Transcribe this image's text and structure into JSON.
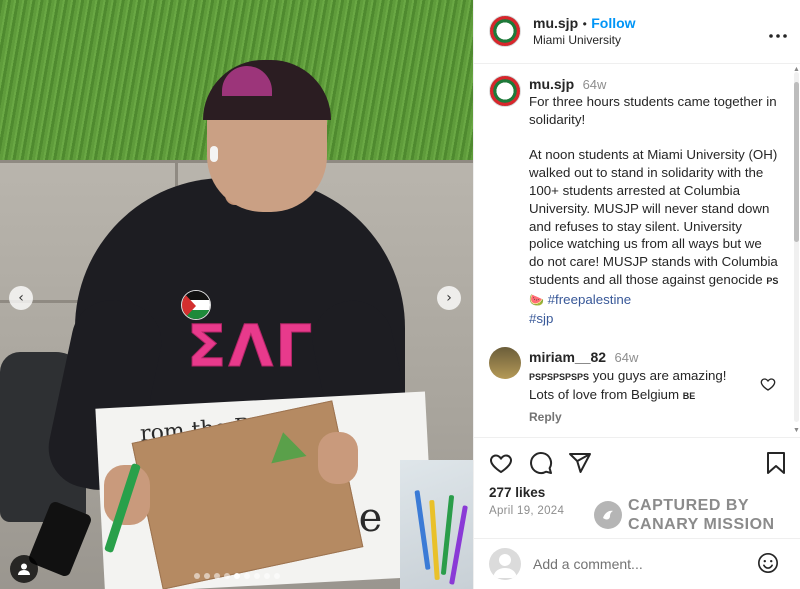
{
  "post_header": {
    "username": "mu.sjp",
    "separator": "•",
    "follow_label": "Follow",
    "location": "Miami University",
    "more_label": "•••"
  },
  "caption": {
    "username": "mu.sjp",
    "time": "64w",
    "text_main": "For three hours students came together in solidarity!\n\nAt noon students at Miami University (OH) walked out to stand in solidarity with the 100+ students arrested at Columbia University. MUSJP will never stand down and refuses to stay silent. University police watching us from all ways but we do not care! MUSJP stands with Columbia students and all those against genocide ",
    "flag": "PS",
    "emoji": "🍉",
    "hashtag1": "#freepalestine",
    "hashtag2": "#sjp"
  },
  "comment": {
    "username": "miriam__82",
    "time": "64w",
    "text_flag": "PSPSPSPSPS",
    "text_line1": " you guys are amazing!",
    "text_line2": "Lots of love from Belgium ",
    "flag_be": "BE",
    "reply_label": "Reply"
  },
  "actions": {
    "likes": "277 likes",
    "date": "April 19, 2024"
  },
  "watermark": {
    "line1": "CAPTURED BY",
    "line2": "CANARY MISSION"
  },
  "add_comment": {
    "placeholder": "Add a comment..."
  },
  "photo": {
    "letters": "ΣΛΓ",
    "poster_text": "rom the R",
    "poster_text2": "ee",
    "carousel_dots": 9,
    "active_dot": 4
  },
  "colors": {
    "link": "#0095f6",
    "hashtag": "#385898",
    "muted": "#8e8e8e",
    "sweatshirt_letters": "#e83a8c"
  }
}
